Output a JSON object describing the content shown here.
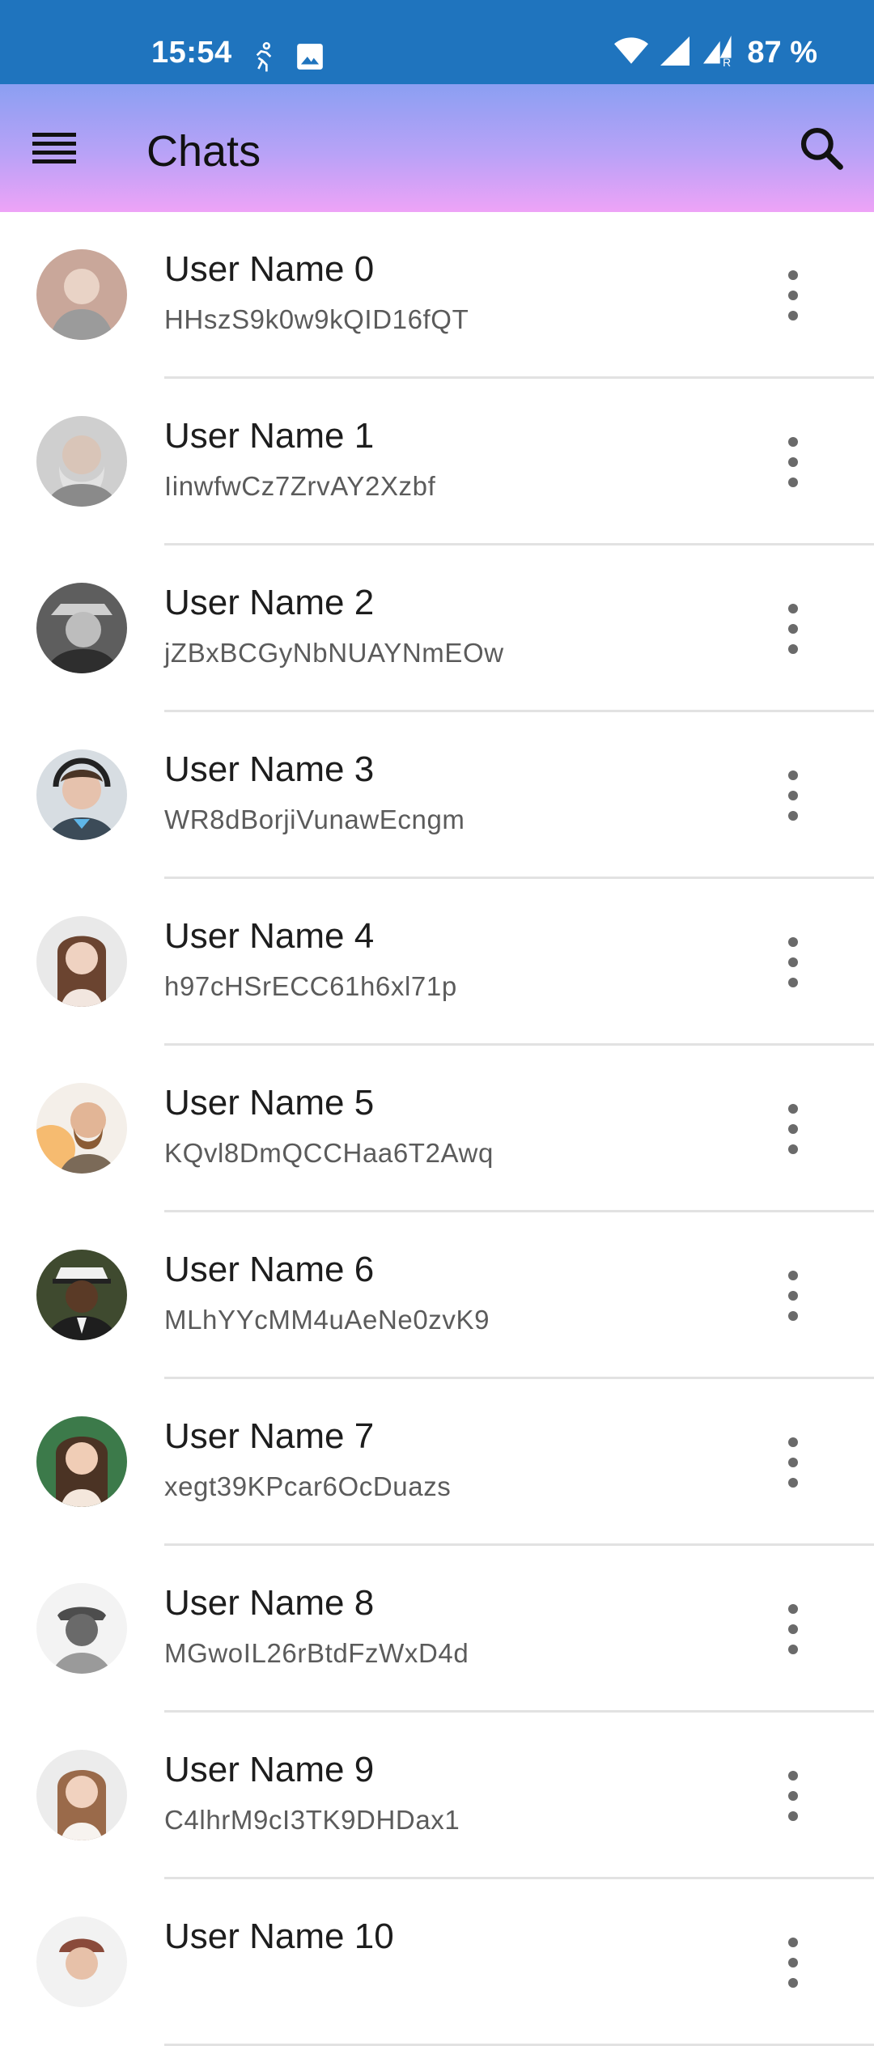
{
  "status_bar": {
    "time": "15:54",
    "battery": "87 %",
    "icons": [
      "activity-icon",
      "image-icon",
      "wifi-icon",
      "signal-icon",
      "signal-roaming-icon"
    ]
  },
  "app_bar": {
    "title": "Chats",
    "menu_icon": "menu-icon",
    "search_icon": "search-icon",
    "gradient": [
      "#8b9ff2",
      "#eea3f7"
    ]
  },
  "chats": [
    {
      "name": "User Name 0",
      "message": "HHszS9k0w9kQID16fQT",
      "avatar_color": "#c9a79a"
    },
    {
      "name": "User Name 1",
      "message": "IinwfwCz7ZrvAY2Xzbf",
      "avatar_color": "#9a9a9a"
    },
    {
      "name": "User Name 2",
      "message": "jZBxBCGyNbNUAYNmEOw",
      "avatar_color": "#6f6f6f"
    },
    {
      "name": "User Name 3",
      "message": "WR8dBorjiVunawEcngm",
      "avatar_color": "#4a5b6a"
    },
    {
      "name": "User Name 4",
      "message": "h97cHSrECC61h6xl71p",
      "avatar_color": "#8f6a55"
    },
    {
      "name": "User Name 5",
      "message": "KQvl8DmQCCHaa6T2Awq",
      "avatar_color": "#d8a46a"
    },
    {
      "name": "User Name 6",
      "message": "MLhYYcMM4uAeNe0zvK9",
      "avatar_color": "#3f4a2f"
    },
    {
      "name": "User Name 7",
      "message": "xegt39KPcar6OcDuazs",
      "avatar_color": "#3c7a4a"
    },
    {
      "name": "User Name 8",
      "message": "MGwoIL26rBtdFzWxD4d",
      "avatar_color": "#b5b5b5"
    },
    {
      "name": "User Name 9",
      "message": "C4lhrM9cI3TK9DHDax1",
      "avatar_color": "#a57a62"
    },
    {
      "name": "User Name 10",
      "message": "",
      "avatar_color": "#8a4a3a"
    }
  ]
}
